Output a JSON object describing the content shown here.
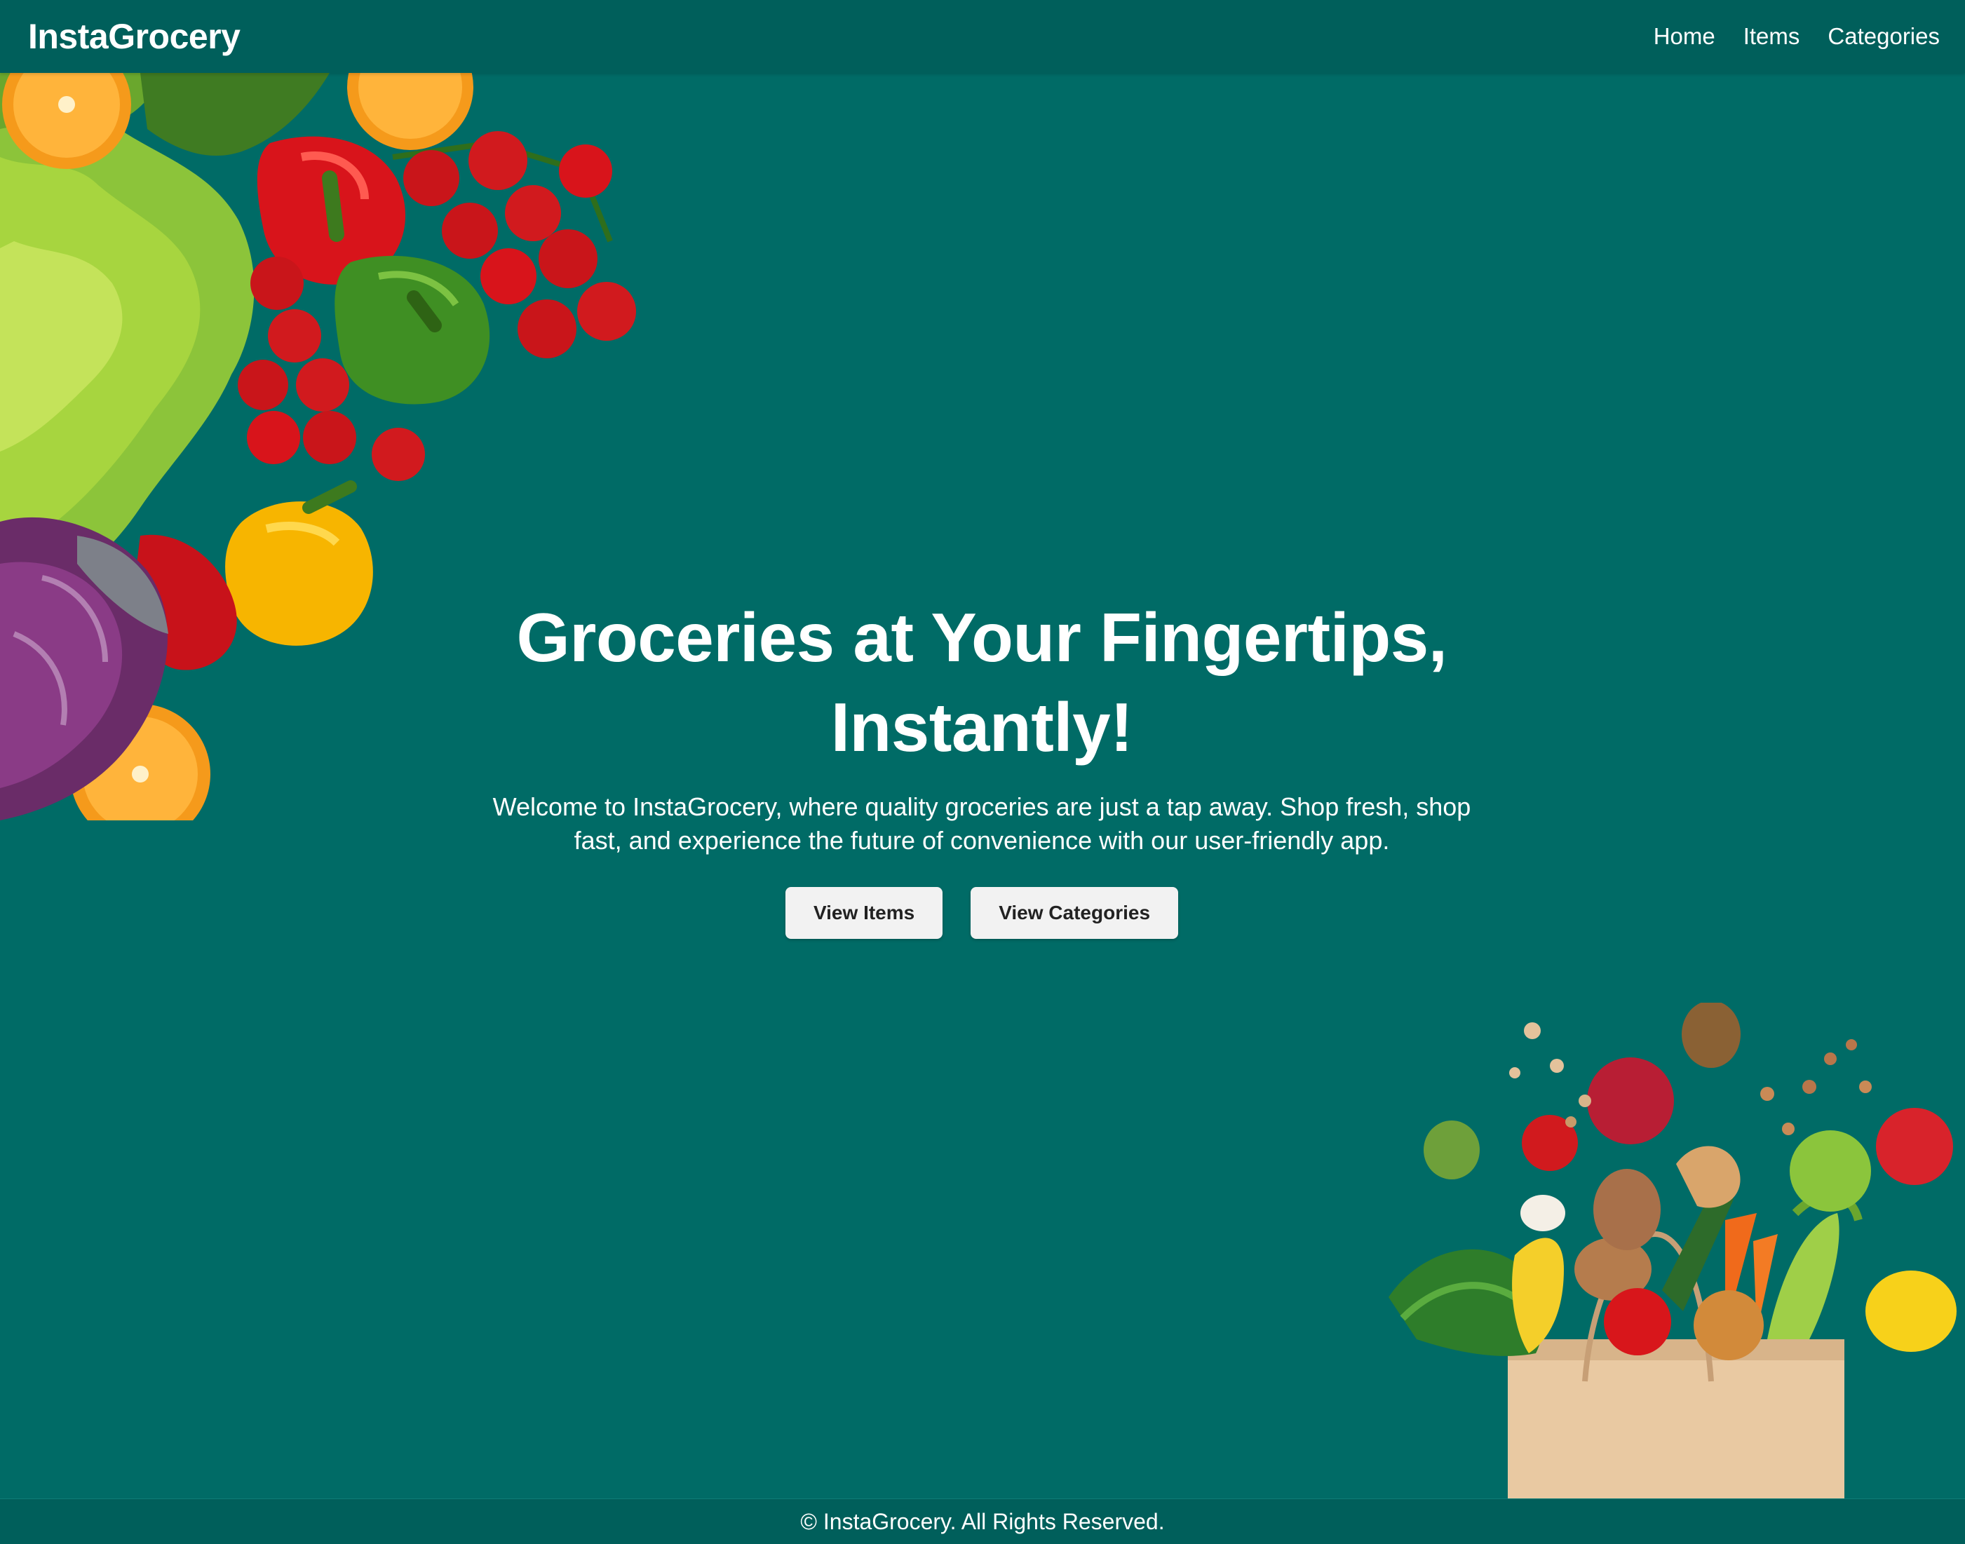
{
  "navbar": {
    "brand": "InstaGrocery",
    "links": [
      {
        "label": "Home"
      },
      {
        "label": "Items"
      },
      {
        "label": "Categories"
      }
    ]
  },
  "hero": {
    "title_line1": "Groceries at Your Fingertips,",
    "title_line2": "Instantly!",
    "subtitle": "Welcome to InstaGrocery, where quality groceries are just a tap away. Shop fresh, shop fast, and experience the future of convenience with our user-friendly app.",
    "buttons": {
      "view_items": "View Items",
      "view_categories": "View Categories"
    }
  },
  "footer": {
    "text": "© InstaGrocery. All Rights Reserved."
  },
  "images": {
    "top_left": "vegetables-cluster-image",
    "bottom_right": "grocery-bag-image"
  },
  "colors": {
    "background": "#006b66",
    "navbar": "#005f5b",
    "button": "#f2f2f2",
    "button_text": "#222222",
    "text": "#ffffff"
  }
}
